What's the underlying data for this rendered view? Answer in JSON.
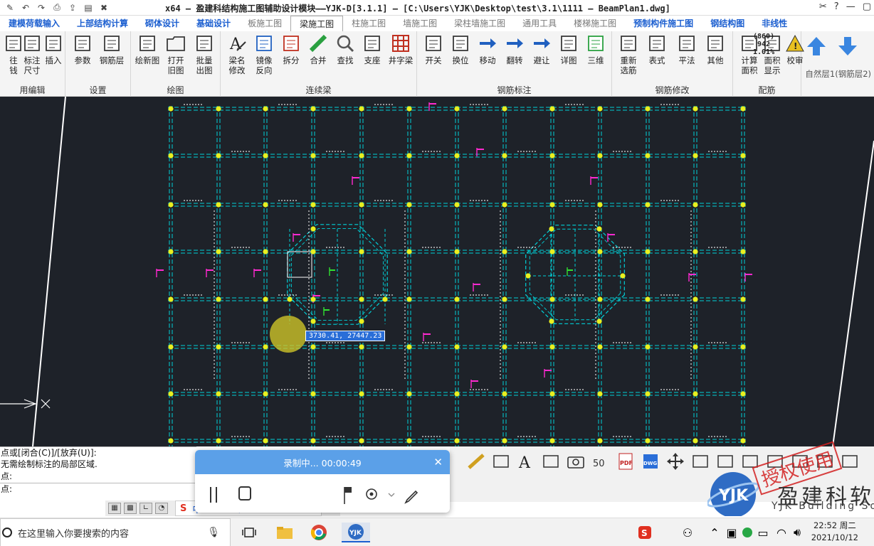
{
  "titlebar": {
    "title": "x64 – 盈建科结构施工图辅助设计模块——YJK-D[3.1.1] – [C:\\Users\\YJK\\Desktop\\test\\3.1\\1111 – BeamPlan1.dwg]"
  },
  "module_tabs": [
    {
      "label": "建模荷载输入",
      "style": "blue"
    },
    {
      "label": "上部结构计算",
      "style": "blue"
    },
    {
      "label": "砌体设计",
      "style": "blue"
    },
    {
      "label": "基础设计",
      "style": "blue"
    },
    {
      "label": "板施工图",
      "style": "gray"
    },
    {
      "label": "梁施工图",
      "style": "active"
    },
    {
      "label": "柱施工图",
      "style": "gray"
    },
    {
      "label": "墙施工图",
      "style": "gray"
    },
    {
      "label": "梁柱墙施工图",
      "style": "gray"
    },
    {
      "label": "通用工具",
      "style": "gray"
    },
    {
      "label": "楼梯施工图",
      "style": "gray"
    },
    {
      "label": "预制构件施工图",
      "style": "blue"
    },
    {
      "label": "钢结构图",
      "style": "blue"
    },
    {
      "label": "非线性",
      "style": "blue"
    }
  ],
  "ribbon": {
    "groups": [
      {
        "title": "用编辑",
        "buttons": [
          {
            "label": "往\n钱",
            "icon": "partial-icon"
          },
          {
            "label": "标注\n尺寸",
            "icon": "dimension-icon"
          },
          {
            "label": "插入",
            "icon": "insert-table-icon"
          }
        ]
      },
      {
        "title": "设置",
        "buttons": [
          {
            "label": "参数",
            "icon": "parameters-icon"
          },
          {
            "label": "钢筋层",
            "icon": "rebar-layer-icon"
          }
        ]
      },
      {
        "title": "绘图",
        "buttons": [
          {
            "label": "绘新图",
            "icon": "new-drawing-icon"
          },
          {
            "label": "打开\n旧图",
            "icon": "open-folder-icon"
          },
          {
            "label": "批量\n出图",
            "icon": "batch-output-icon"
          }
        ]
      },
      {
        "title": "连续梁",
        "buttons": [
          {
            "label": "梁名\n修改",
            "icon": "rename-beam-icon"
          },
          {
            "label": "镜像\n反向",
            "icon": "mirror-icon"
          },
          {
            "label": "拆分",
            "icon": "split-icon"
          },
          {
            "label": "合并",
            "icon": "merge-icon"
          },
          {
            "label": "查找",
            "icon": "find-icon"
          },
          {
            "label": "支座",
            "icon": "support-icon"
          },
          {
            "label": "井字梁",
            "icon": "grid-beam-icon"
          }
        ]
      },
      {
        "title": "钢筋标注",
        "buttons": [
          {
            "label": "开关",
            "icon": "toggle-icon"
          },
          {
            "label": "换位",
            "icon": "swap-icon"
          },
          {
            "label": "移动",
            "icon": "move-icon"
          },
          {
            "label": "翻转",
            "icon": "flip-icon"
          },
          {
            "label": "避让",
            "icon": "avoid-icon"
          },
          {
            "label": "详图",
            "icon": "detail-icon"
          },
          {
            "label": "三维",
            "icon": "3d-icon"
          }
        ]
      },
      {
        "title": "钢筋修改",
        "buttons": [
          {
            "label": "重新\n选筋",
            "icon": "reselect-rebar-icon"
          },
          {
            "label": "表式",
            "icon": "table-style-icon"
          },
          {
            "label": "平法",
            "icon": "plane-method-icon"
          },
          {
            "label": "其他",
            "icon": "other-icon"
          }
        ]
      },
      {
        "title": "配筋",
        "buttons": [
          {
            "label": "计算\n面积",
            "icon": "calc-area-icon"
          },
          {
            "label": "面积\n显示",
            "icon": "area-display-icon"
          },
          {
            "label": "校审",
            "icon": "warning-icon"
          }
        ]
      }
    ],
    "area_readout": [
      "(860)",
      "942",
      "1.01%"
    ],
    "layer_label": "自然层1(钢筋层2)"
  },
  "canvas": {
    "coord_readout": "3730.41, 27447.23"
  },
  "command_lines": [
    "点或[闭合(C)]/[放弃(U)]:",
    "无需绘制标注的局部区域.",
    "点:",
    "点:"
  ],
  "recording": {
    "status": "录制中... 00:00:49"
  },
  "ime": {
    "label": "中"
  },
  "logo": {
    "main": "盈建科软",
    "sub": "YJK Building Sof",
    "stamp": "授权使用"
  },
  "taskbar": {
    "search_placeholder": "在这里输入你要搜索的内容",
    "time": "22:52 周二",
    "date": "2021/10/12"
  },
  "colors": {
    "canvas_bg": "#1e2229",
    "gridline": "#00d0d8",
    "node": "#e8f020",
    "annotation": "#ff2ad0",
    "accent_blue": "#1c5fd0"
  }
}
